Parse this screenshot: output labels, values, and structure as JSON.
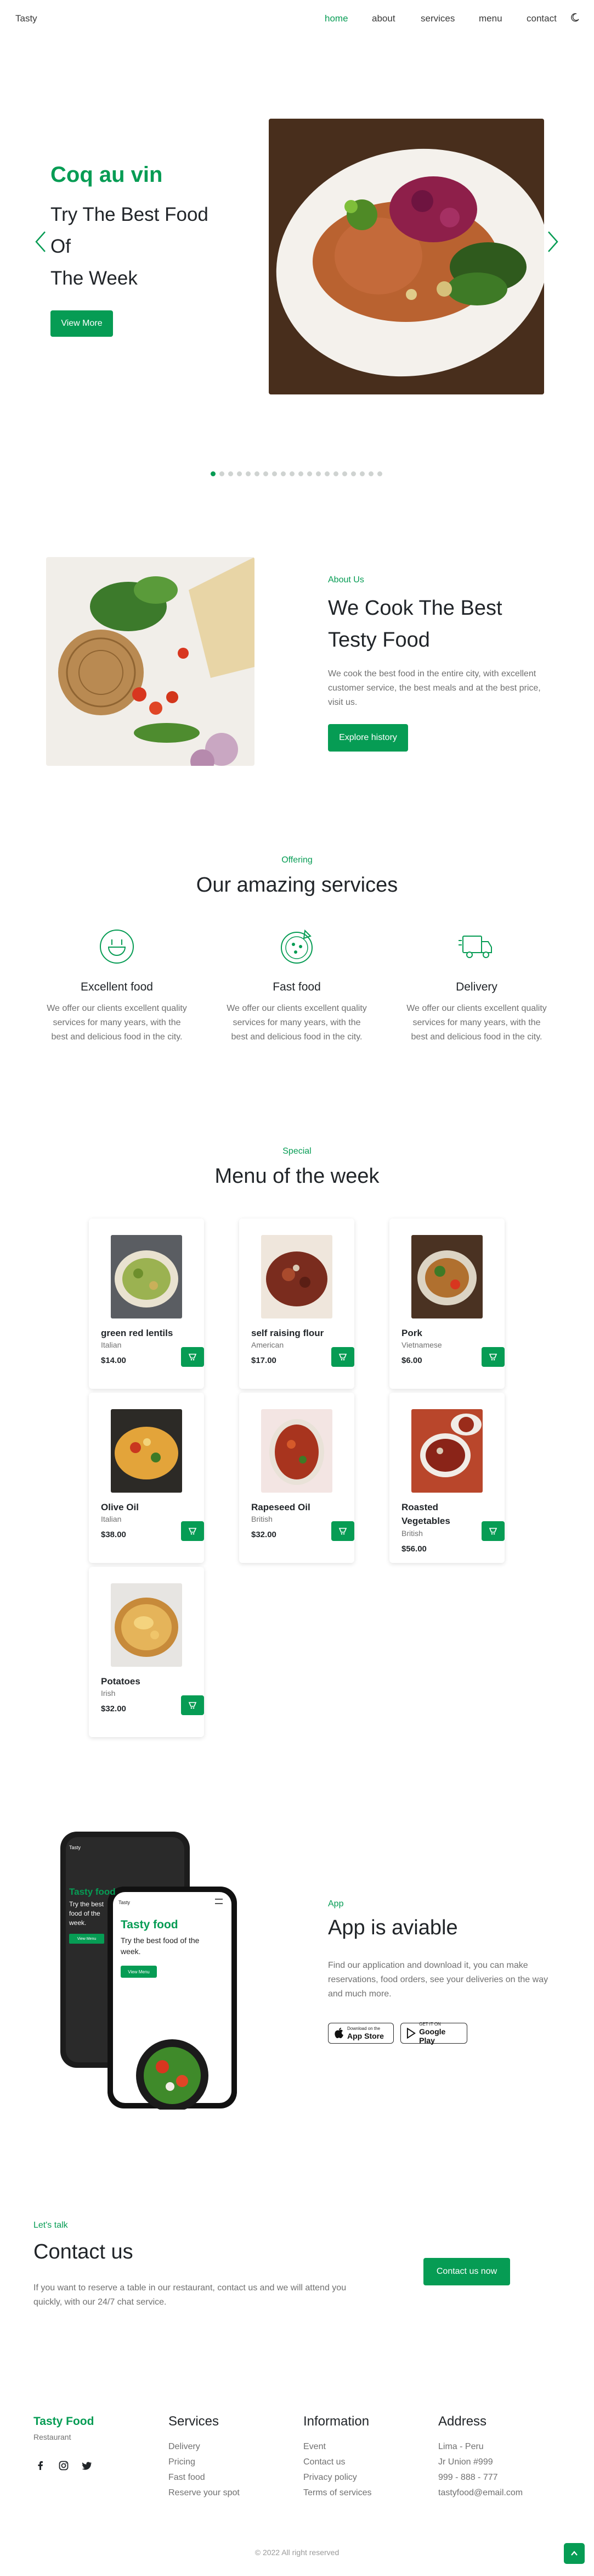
{
  "header": {
    "logo": "Tasty",
    "nav": [
      "home",
      "about",
      "services",
      "menu",
      "contact"
    ],
    "active_nav": "home"
  },
  "hero": {
    "subtitle": "Coq au vin",
    "title_lines": [
      "Try The Best Food",
      "Of",
      "The Week"
    ],
    "button_label": "View More",
    "slide_count": 20,
    "active_slide": 1
  },
  "about": {
    "subtitle": "About Us",
    "title_lines": [
      "We Cook The Best",
      "Testy Food"
    ],
    "description": "We cook the best food in the entire city, with excellent customer service, the best meals and at the best price, visit us.",
    "button_label": "Explore history"
  },
  "services": {
    "subtitle": "Offering",
    "title": "Our amazing services",
    "items": [
      {
        "name": "Excellent food",
        "icon": "food-bowl-icon",
        "desc": "We offer our clients excellent quality services for many years, with the best and delicious food in the city."
      },
      {
        "name": "Fast food",
        "icon": "pizza-icon",
        "desc": "We offer our clients excellent quality services for many years, with the best and delicious food in the city."
      },
      {
        "name": "Delivery",
        "icon": "delivery-truck-icon",
        "desc": "We offer our clients excellent quality services for many years, with the best and delicious food in the city."
      }
    ]
  },
  "menu": {
    "subtitle": "Special",
    "title": "Menu of the week",
    "items": [
      {
        "name": "green red lentils",
        "origin": "Italian",
        "price": "$14.00"
      },
      {
        "name": "self raising flour",
        "origin": "American",
        "price": "$17.00"
      },
      {
        "name": "Pork",
        "origin": "Vietnamese",
        "price": "$6.00"
      },
      {
        "name": "Olive Oil",
        "origin": "Italian",
        "price": "$38.00"
      },
      {
        "name": "Rapeseed Oil",
        "origin": "British",
        "price": "$32.00"
      },
      {
        "name": "Roasted Vegetables",
        "origin": "British",
        "price": "$56.00"
      },
      {
        "name": "Potatoes",
        "origin": "Irish",
        "price": "$32.00"
      }
    ]
  },
  "app": {
    "subtitle": "App",
    "title": "App is aviable",
    "description": "Find our application and download it, you can make reservations, food orders, see your deliveries on the way and much more.",
    "phone": {
      "logo": "Tasty",
      "subtitle": "Tasty food",
      "title": "Try the best food of the week.",
      "button": "View Menu"
    },
    "stores": [
      {
        "small": "Download on the",
        "large": "App Store"
      },
      {
        "small": "GET IT ON",
        "large": "Google Play"
      }
    ]
  },
  "contact": {
    "subtitle": "Let's talk",
    "title": "Contact us",
    "description": "If you want to reserve a table in our restaurant, contact us and we will attend you quickly, with our 24/7 chat service.",
    "button_label": "Contact us now"
  },
  "footer": {
    "brand": "Tasty Food",
    "brand_sub": "Restaurant",
    "columns": [
      {
        "title": "Services",
        "items": [
          "Delivery",
          "Pricing",
          "Fast food",
          "Reserve your spot"
        ]
      },
      {
        "title": "Information",
        "items": [
          "Event",
          "Contact us",
          "Privacy policy",
          "Terms of services"
        ]
      },
      {
        "title": "Address",
        "items": [
          "Lima - Peru",
          "Jr Union #999",
          "999 - 888 - 777",
          "tastyfood@email.com"
        ]
      }
    ],
    "copyright": "© 2022 All right reserved"
  },
  "colors": {
    "accent": "#069c54",
    "text": "#212529",
    "muted": "#707070"
  }
}
